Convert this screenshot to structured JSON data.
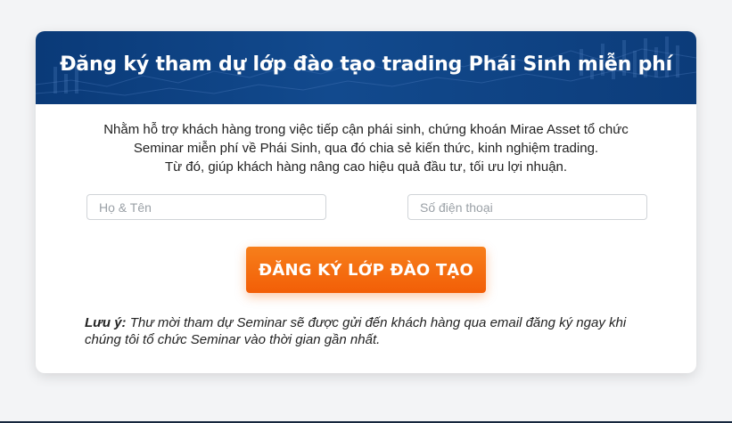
{
  "header": {
    "title": "Đăng ký tham dự lớp đào tạo trading Phái Sinh miễn phí"
  },
  "intro": {
    "line1": "Nhằm hỗ trợ khách hàng trong việc tiếp cận phái sinh, chứng khoán Mirae Asset tổ chức",
    "line2": "Seminar miễn phí về Phái Sinh, qua đó chia sẻ kiến thức, kinh nghiệm trading.",
    "line3": "Từ đó, giúp khách hàng nâng cao hiệu quả đầu tư, tối ưu lợi nhuận."
  },
  "form": {
    "name_placeholder": "Họ & Tên",
    "name_value": "",
    "phone_placeholder": "Số điện thoại",
    "phone_value": "",
    "submit_label": "ĐĂNG KÝ LỚP ĐÀO TẠO"
  },
  "note": {
    "label": "Lưu ý:",
    "text": " Thư mời tham dự Seminar sẽ được gửi đến khách hàng qua email đăng ký ngay khi chúng tôi tổ chức Seminar vào thời gian gần nhất."
  },
  "colors": {
    "header_bg": "#0c3f80",
    "button_bg": "#f46a10",
    "text": "#222222"
  }
}
